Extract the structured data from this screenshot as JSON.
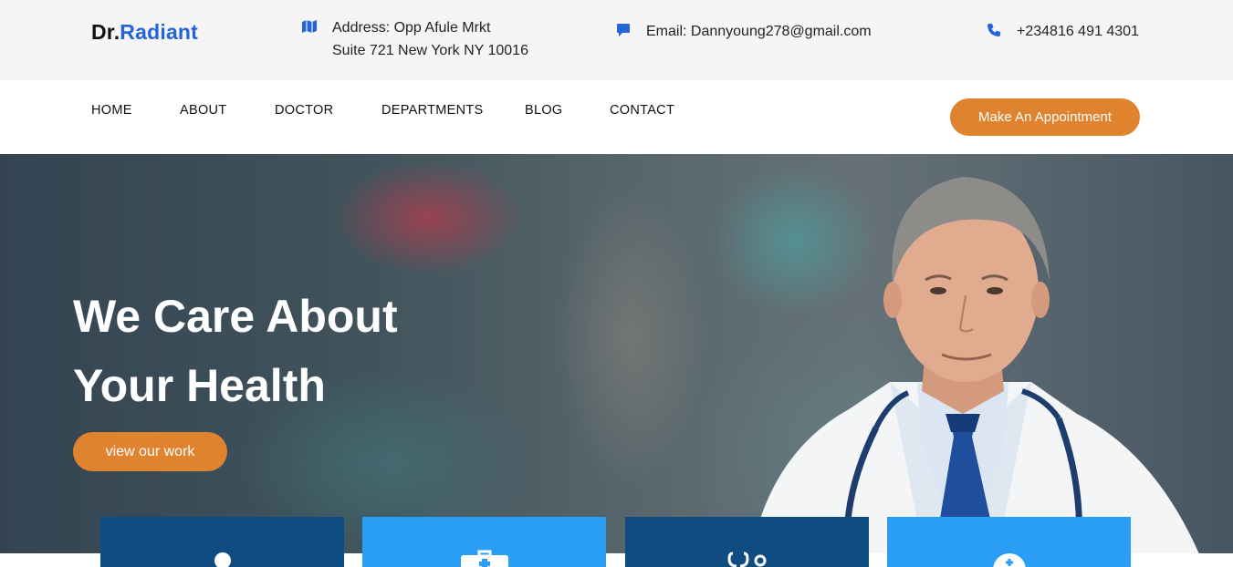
{
  "header": {
    "logo_prefix": "Dr.",
    "logo_suffix": "Radiant",
    "address_line1": "Address: Opp Afule Mrkt",
    "address_line2": "Suite 721 New York NY 10016",
    "email": "Email: Dannyoung278@gmail.com",
    "phone": "+234816 491 4301"
  },
  "nav": {
    "items": [
      {
        "label": "HOME"
      },
      {
        "label": "ABOUT"
      },
      {
        "label": "DOCTOR"
      },
      {
        "label": "DEPARTMENTS"
      },
      {
        "label": "BLOG"
      },
      {
        "label": "CONTACT"
      }
    ],
    "cta_label": "Make An Appointment"
  },
  "hero": {
    "title_line1": "We Care About",
    "title_line2": "Your Health",
    "button_label": "view our work"
  },
  "colors": {
    "brand_blue": "#2563d9",
    "accent_orange": "#e0832e",
    "card_dark": "#0f4c81",
    "card_light": "#2a9df4"
  },
  "icons": {
    "address": "map-icon",
    "email": "chat-icon",
    "phone": "phone-icon",
    "cards": [
      "person-icon",
      "medical-kit-icon",
      "stethoscope-icon",
      "plus-circle-icon"
    ]
  }
}
